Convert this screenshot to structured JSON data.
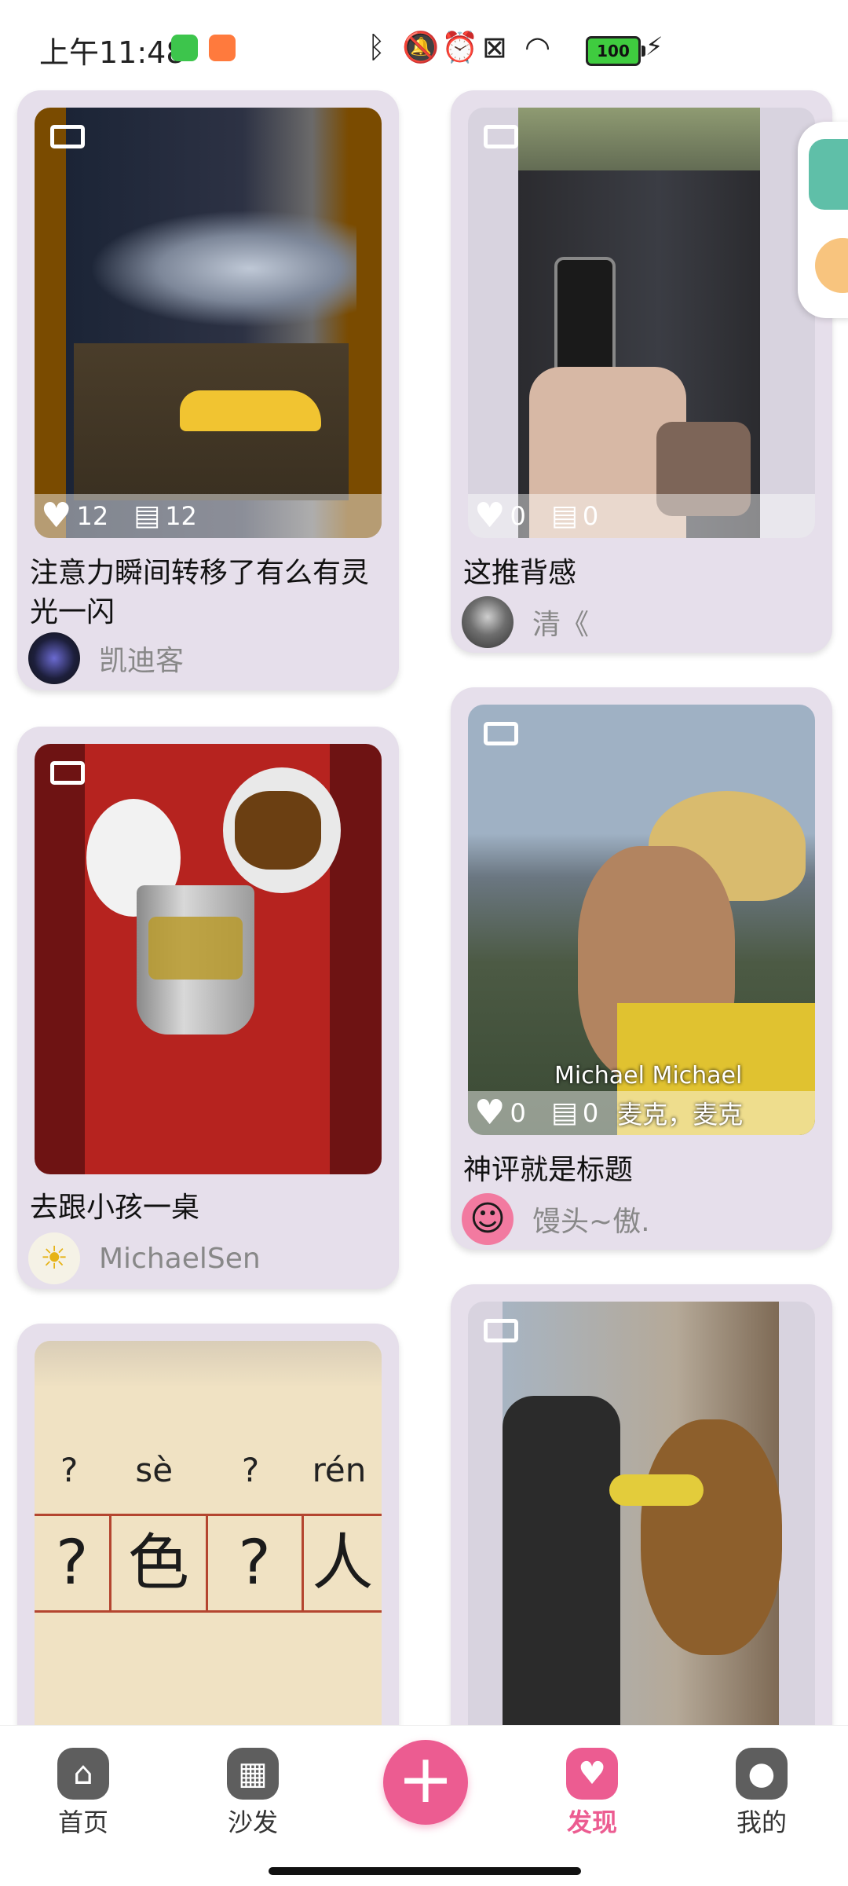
{
  "status_bar": {
    "time": "上午11:48",
    "battery": "100",
    "icons": [
      "bluetooth-icon",
      "mute-icon",
      "alarm-icon",
      "screen-icon",
      "wifi-icon",
      "battery-icon",
      "charging-icon"
    ]
  },
  "feed": {
    "left": [
      {
        "title": "注意力瞬间转移了有么有灵光一闪",
        "author": "凯迪客",
        "likes": "12",
        "comments": "12"
      },
      {
        "title": "去跟小孩一桌",
        "author": "MichaelSen"
      },
      {
        "pinyin": [
          "?",
          "sè",
          "?",
          "rén"
        ],
        "chars": [
          "?",
          "色",
          "?",
          "人"
        ]
      }
    ],
    "right": [
      {
        "title": "这推背感",
        "author": "清《",
        "likes": "0",
        "comments": "0"
      },
      {
        "title": "神评就是标题",
        "author": "馒头~傲.",
        "likes": "0",
        "comments": "0",
        "caption_en": "Michael Michael",
        "caption_cn": "麦克，麦克"
      },
      {}
    ]
  },
  "nav": {
    "items": [
      {
        "label": "首页",
        "icon": "home-icon"
      },
      {
        "label": "沙发",
        "icon": "grid-icon"
      },
      {
        "label": "",
        "icon": "plus-icon"
      },
      {
        "label": "发现",
        "icon": "heart-icon"
      },
      {
        "label": "我的",
        "icon": "user-icon"
      }
    ],
    "active_color": "#ec5c91"
  }
}
